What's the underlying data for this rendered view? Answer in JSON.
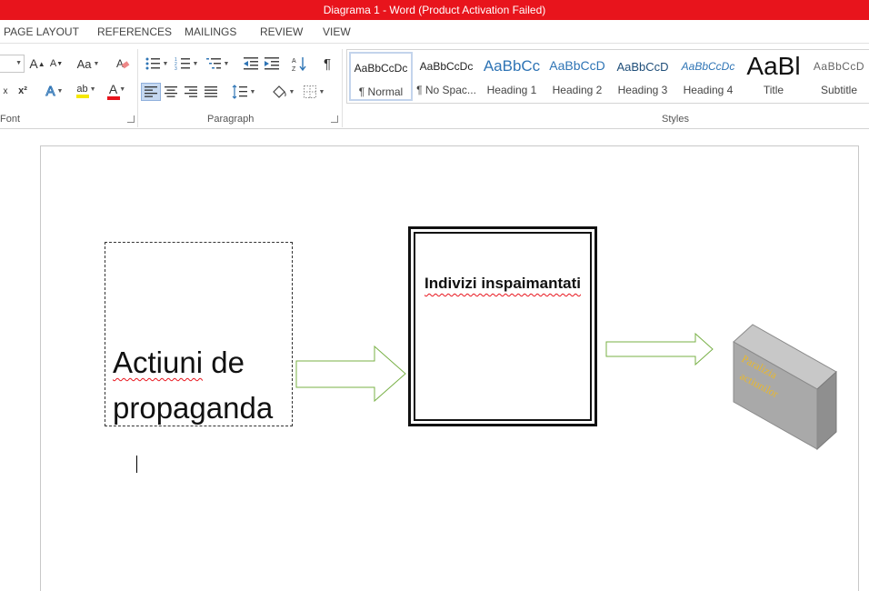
{
  "title": "Diagrama 1 -  Word (Product Activation Failed)",
  "tabs": [
    "PAGE LAYOUT",
    "REFERENCES",
    "MAILINGS",
    "REVIEW",
    "VIEW"
  ],
  "ribbon": {
    "groups": {
      "font": "Font",
      "paragraph": "Paragraph",
      "styles": "Styles"
    },
    "font_case_label": "Aa",
    "font_grow_label": "A",
    "font_shrink_label": "A",
    "effects_label": "A",
    "font_color_label": "A",
    "highlight_label": "ab",
    "subscript_label": "x",
    "superscript_label": "x²",
    "pilcrow": "¶",
    "sort_label": "A↓",
    "styles": [
      {
        "preview": "AaBbCcDc",
        "name": "¶ Normal",
        "selected": true
      },
      {
        "preview": "AaBbCcDc",
        "name": "¶ No Spac..."
      },
      {
        "preview": "AaBbCc",
        "name": "Heading 1"
      },
      {
        "preview": "AaBbCcD",
        "name": "Heading 2"
      },
      {
        "preview": "AaBbCcD",
        "name": "Heading 3"
      },
      {
        "preview": "AaBbCcDc",
        "name": "Heading 4"
      },
      {
        "preview": "AaBl",
        "name": "Title"
      },
      {
        "preview": "AaBbCcD",
        "name": "Subtitle"
      }
    ]
  },
  "document": {
    "box1_line1_word1": "Actiuni",
    "box1_line1_word2": " de",
    "box1_line2": "propaganda",
    "box2_text": "Indivizi inspaimantati",
    "box3_line1": "Paralizia",
    "box3_line2": "actiunilor"
  },
  "colors": {
    "titlebar": "#e8141c",
    "arrow_outline": "#78b046",
    "cube_fill": "#a9a9a9",
    "cube_text": "#e8b830",
    "spellcheck": "#e8141c",
    "style_heading": "#2e74b5"
  }
}
